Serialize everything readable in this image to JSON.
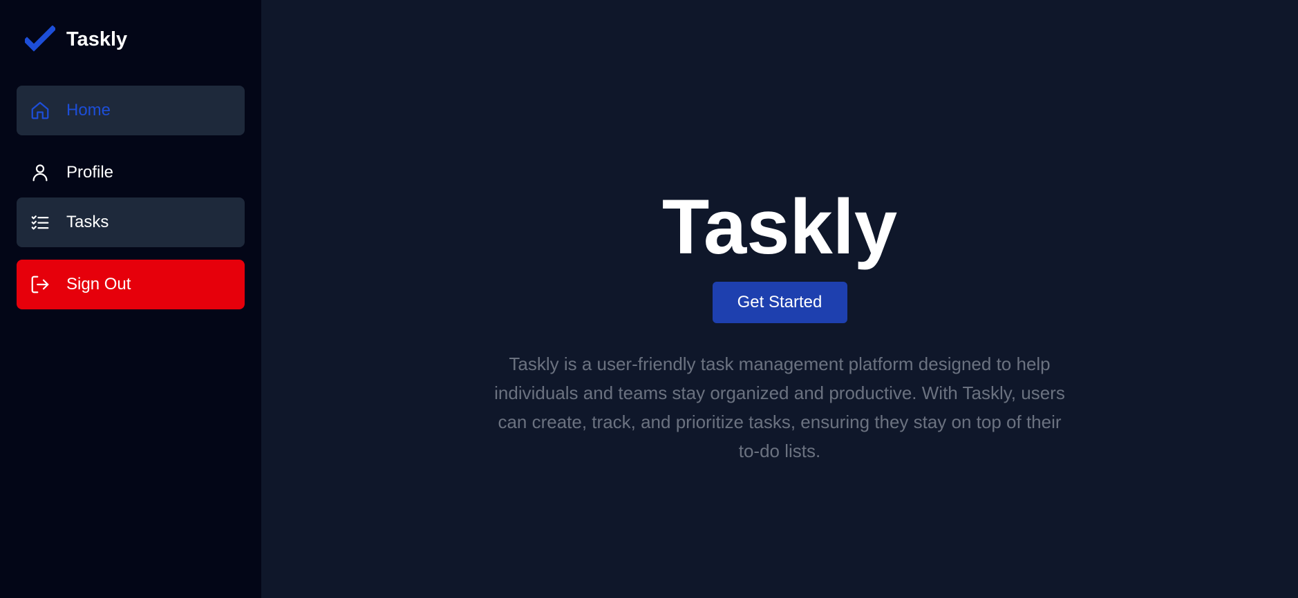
{
  "brand": {
    "name": "Taskly",
    "icon": "checkmark-icon",
    "icon_color": "#1d4ed8"
  },
  "sidebar": {
    "items": [
      {
        "label": "Home",
        "icon": "home-icon",
        "state": "active"
      },
      {
        "label": "Profile",
        "icon": "user-icon",
        "state": "default"
      },
      {
        "label": "Tasks",
        "icon": "task-list-icon",
        "state": "hover"
      },
      {
        "label": "Sign Out",
        "icon": "sign-out-icon",
        "state": "danger"
      }
    ]
  },
  "hero": {
    "title": "Taskly",
    "cta_label": "Get Started",
    "description": "Taskly is a user-friendly task management platform designed to help individuals and teams stay organized and productive. With Taskly, users can create, track, and prioritize tasks, ensuring they stay on top of their to-do lists."
  },
  "colors": {
    "sidebar_bg": "#030617",
    "main_bg": "#0f172a",
    "active_item_bg": "#1e293b",
    "accent": "#1d4ed8",
    "danger": "#e6000b",
    "button": "#1e40af",
    "muted_text": "#6b7280"
  }
}
